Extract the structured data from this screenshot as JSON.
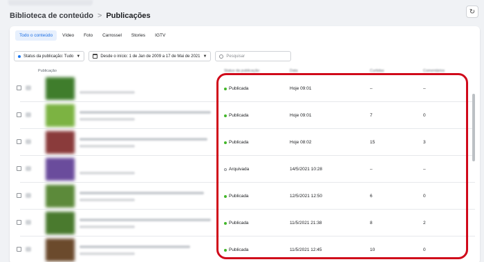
{
  "breadcrumb": {
    "parent": "Biblioteca de conteúdo",
    "separator": ">",
    "current": "Publicações"
  },
  "refresh_icon": "refresh-icon",
  "tabs": [
    {
      "label": "Todo o conteúdo",
      "active": true
    },
    {
      "label": "Vídeo",
      "active": false
    },
    {
      "label": "Foto",
      "active": false
    },
    {
      "label": "Carrossel",
      "active": false
    },
    {
      "label": "Stories",
      "active": false
    },
    {
      "label": "IGTV",
      "active": false
    }
  ],
  "filters": {
    "status": "Status da publicação: Tudo",
    "date_range": "Desde o início: 1 de Jan de 2009 a 17 de Mai de 2021",
    "search_placeholder": "Pesquisar"
  },
  "table": {
    "columns": [
      "Publicação",
      "Status da publicação",
      "Data",
      "Curtidas",
      "Comentários"
    ],
    "rows": [
      {
        "status": "Publicada",
        "date": "Hoje 09:01",
        "likes": "–",
        "comments": "–",
        "thumb_color": "#3f7d2c"
      },
      {
        "status": "Publicada",
        "date": "Hoje 09:01",
        "likes": "7",
        "comments": "0",
        "thumb_color": "#7cb342"
      },
      {
        "status": "Publicada",
        "date": "Hoje 08:02",
        "likes": "15",
        "comments": "3",
        "thumb_color": "#8a3b3b"
      },
      {
        "status": "Arquivada",
        "date": "14/5/2021 10:28",
        "likes": "–",
        "comments": "–",
        "thumb_color": "#6a4c9c"
      },
      {
        "status": "Publicada",
        "date": "12/5/2021 12:50",
        "likes": "6",
        "comments": "0",
        "thumb_color": "#5c8a3a"
      },
      {
        "status": "Publicada",
        "date": "11/5/2021 21:38",
        "likes": "8",
        "comments": "2",
        "thumb_color": "#4a7a2e"
      },
      {
        "status": "Publicada",
        "date": "11/5/2021 12:45",
        "likes": "10",
        "comments": "0",
        "thumb_color": "#6b4a2c"
      }
    ]
  },
  "colors": {
    "published_dot": "#42b72a",
    "archived_dot": "#8a8d91",
    "highlight": "#d0091a",
    "active_tab": "#1b6ee4"
  }
}
